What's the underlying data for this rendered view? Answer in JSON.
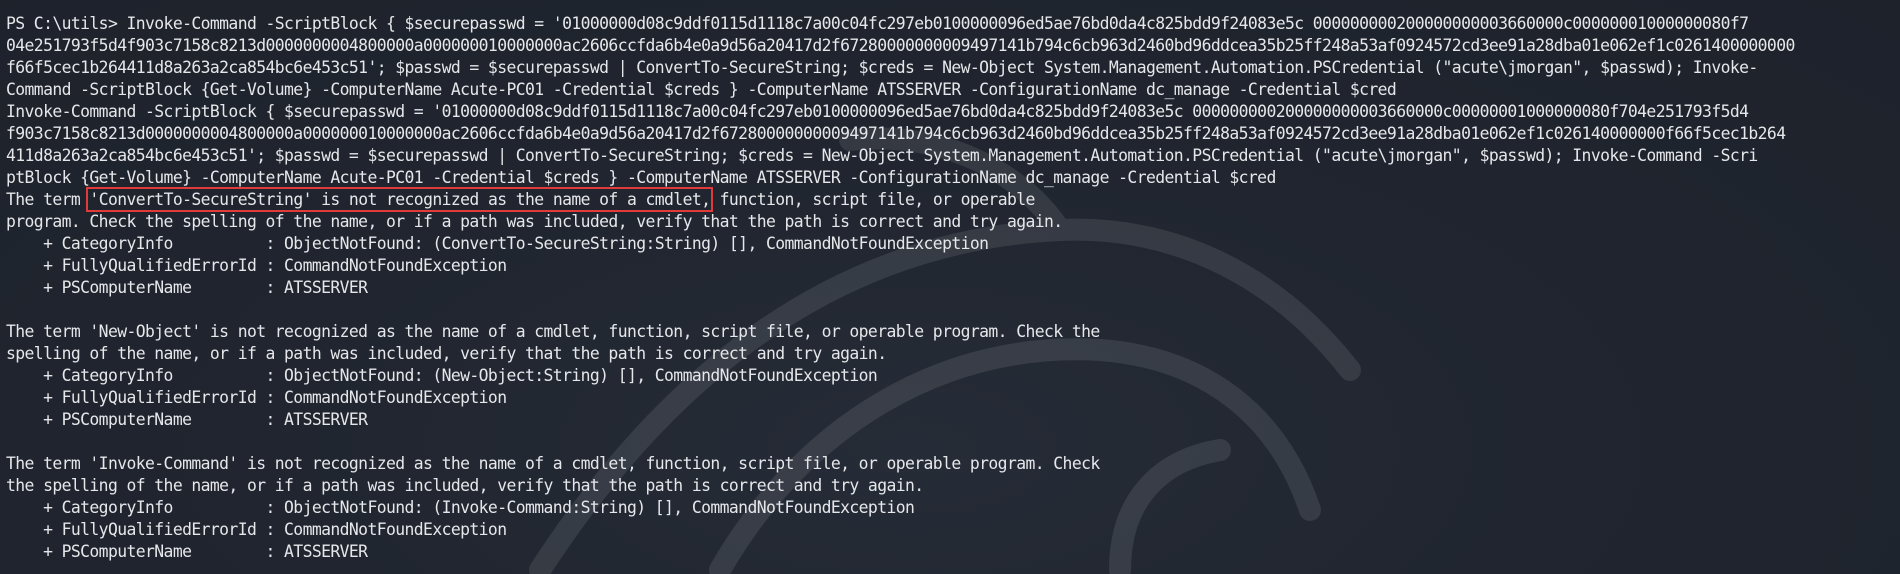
{
  "terminal": {
    "lines": [
      {
        "pre": "PS C:\\utils> Invoke-Command -ScriptBlock { $securepasswd = '01000000d08c9ddf0115d1118c7a00c04fc297eb0100000096ed5ae76bd0da4c825bdd9f24083e5c 000000000200000000003660000c00000001000000080f7"
      },
      {
        "pre": "04e251793f5d4f903c7158c8213d0000000004800000a000000010000000ac2606ccfda6b4e0a9d56a20417d2f67280000000009497141b794c6cb963d2460bd96ddcea35b25ff248a53af0924572cd3ee91a28dba01e062ef1c0261400000000"
      },
      {
        "pre": "f66f5cec1b264411d8a263a2ca854bc6e453c51'; $passwd = $securepasswd | ConvertTo-SecureString; $creds = New-Object System.Management.Automation.PSCredential (\"acute\\jmorgan\", $passwd); Invoke-"
      },
      {
        "pre": "Command -ScriptBlock {Get-Volume} -ComputerName Acute-PC01 -Credential $creds } -ComputerName ATSSERVER -ConfigurationName dc_manage -Credential $cred"
      },
      {
        "pre": "Invoke-Command -ScriptBlock { $securepasswd = '01000000d08c9ddf0115d1118c7a00c04fc297eb0100000096ed5ae76bd0da4c825bdd9f24083e5c 000000000200000000003660000c00000001000000080f704e251793f5d4"
      },
      {
        "pre": "f903c7158c8213d0000000004800000a000000010000000ac2606ccfda6b4e0a9d56a20417d2f67280000000009497141b794c6cb963d2460bd96ddcea35b25ff248a53af0924572cd3ee91a28dba01e062ef1c026140000000f66f5cec1b264"
      },
      {
        "pre": "411d8a263a2ca854bc6e453c51'; $passwd = $securepasswd | ConvertTo-SecureString; $creds = New-Object System.Management.Automation.PSCredential (\"acute\\jmorgan\", $passwd); Invoke-Command -Scri"
      },
      {
        "pre": "ptBlock {Get-Volume} -ComputerName Acute-PC01 -Credential $creds } -ComputerName ATSSERVER -ConfigurationName dc_manage -Credential $cred"
      },
      {
        "pre": "The term ",
        "hl": "'ConvertTo-SecureString' is not recognized as the name of a cmdlet,",
        "post": " function, script file, or operable"
      },
      {
        "pre": "program. Check the spelling of the name, or if a path was included, verify that the path is correct and try again."
      },
      {
        "pre": "    + CategoryInfo          : ObjectNotFound: (ConvertTo-SecureString:String) [], CommandNotFoundException"
      },
      {
        "pre": "    + FullyQualifiedErrorId : CommandNotFoundException"
      },
      {
        "pre": "    + PSComputerName        : ATSSERVER"
      },
      {
        "pre": ""
      },
      {
        "pre": "The term 'New-Object' is not recognized as the name of a cmdlet, function, script file, or operable program. Check the"
      },
      {
        "pre": "spelling of the name, or if a path was included, verify that the path is correct and try again."
      },
      {
        "pre": "    + CategoryInfo          : ObjectNotFound: (New-Object:String) [], CommandNotFoundException"
      },
      {
        "pre": "    + FullyQualifiedErrorId : CommandNotFoundException"
      },
      {
        "pre": "    + PSComputerName        : ATSSERVER"
      },
      {
        "pre": ""
      },
      {
        "pre": "The term 'Invoke-Command' is not recognized as the name of a cmdlet, function, script file, or operable program. Check"
      },
      {
        "pre": "the spelling of the name, or if a path was included, verify that the path is correct and try again."
      },
      {
        "pre": "    + CategoryInfo          : ObjectNotFound: (Invoke-Command:String) [], CommandNotFoundException"
      },
      {
        "pre": "    + FullyQualifiedErrorId : CommandNotFoundException"
      },
      {
        "pre": "    + PSComputerName        : ATSSERVER"
      }
    ],
    "colors": {
      "background": "#1f242e",
      "text": "#e6e7ea",
      "highlight_box": "#e23a3a"
    },
    "watermark_icon": "kali-dragon-icon"
  }
}
